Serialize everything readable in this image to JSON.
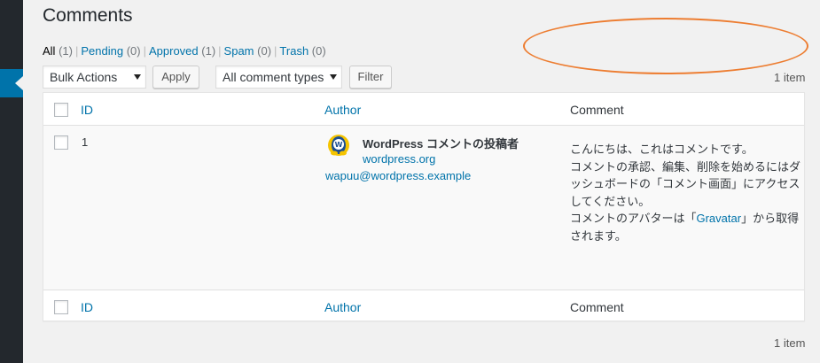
{
  "page": {
    "title": "Comments"
  },
  "filters": [
    {
      "label": "All",
      "count": "(1)",
      "current": true
    },
    {
      "label": "Pending",
      "count": "(0)",
      "current": false
    },
    {
      "label": "Approved",
      "count": "(1)",
      "current": false
    },
    {
      "label": "Spam",
      "count": "(0)",
      "current": false
    },
    {
      "label": "Trash",
      "count": "(0)",
      "current": false
    }
  ],
  "toolbar": {
    "bulk_actions": "Bulk Actions",
    "apply_label": "Apply",
    "comment_types": "All comment types",
    "filter_label": "Filter",
    "items_count": "1 item"
  },
  "table": {
    "columns": {
      "id": "ID",
      "author": "Author",
      "comment": "Comment"
    },
    "rows": [
      {
        "id": "1",
        "author_name": "WordPress コメントの投稿者",
        "author_url": "wordpress.org",
        "author_email": "wapuu@wordpress.example",
        "comment_line1": "こんにちは、これはコメントです。",
        "comment_line2": "コメントの承認、編集、削除を始めるにはダッシュボードの「コメント画面」にアクセスしてください。",
        "comment_line3_before": "コメントのアバターは「",
        "comment_line3_link": "Gravatar",
        "comment_line3_after": "」から取得されます。"
      }
    ]
  },
  "footer": {
    "items_count": "1 item"
  },
  "colors": {
    "annotation_ellipse": "#ed7d31",
    "link": "#0073aa",
    "sidebar": "#23282d",
    "sidebar_active": "#0073aa"
  }
}
